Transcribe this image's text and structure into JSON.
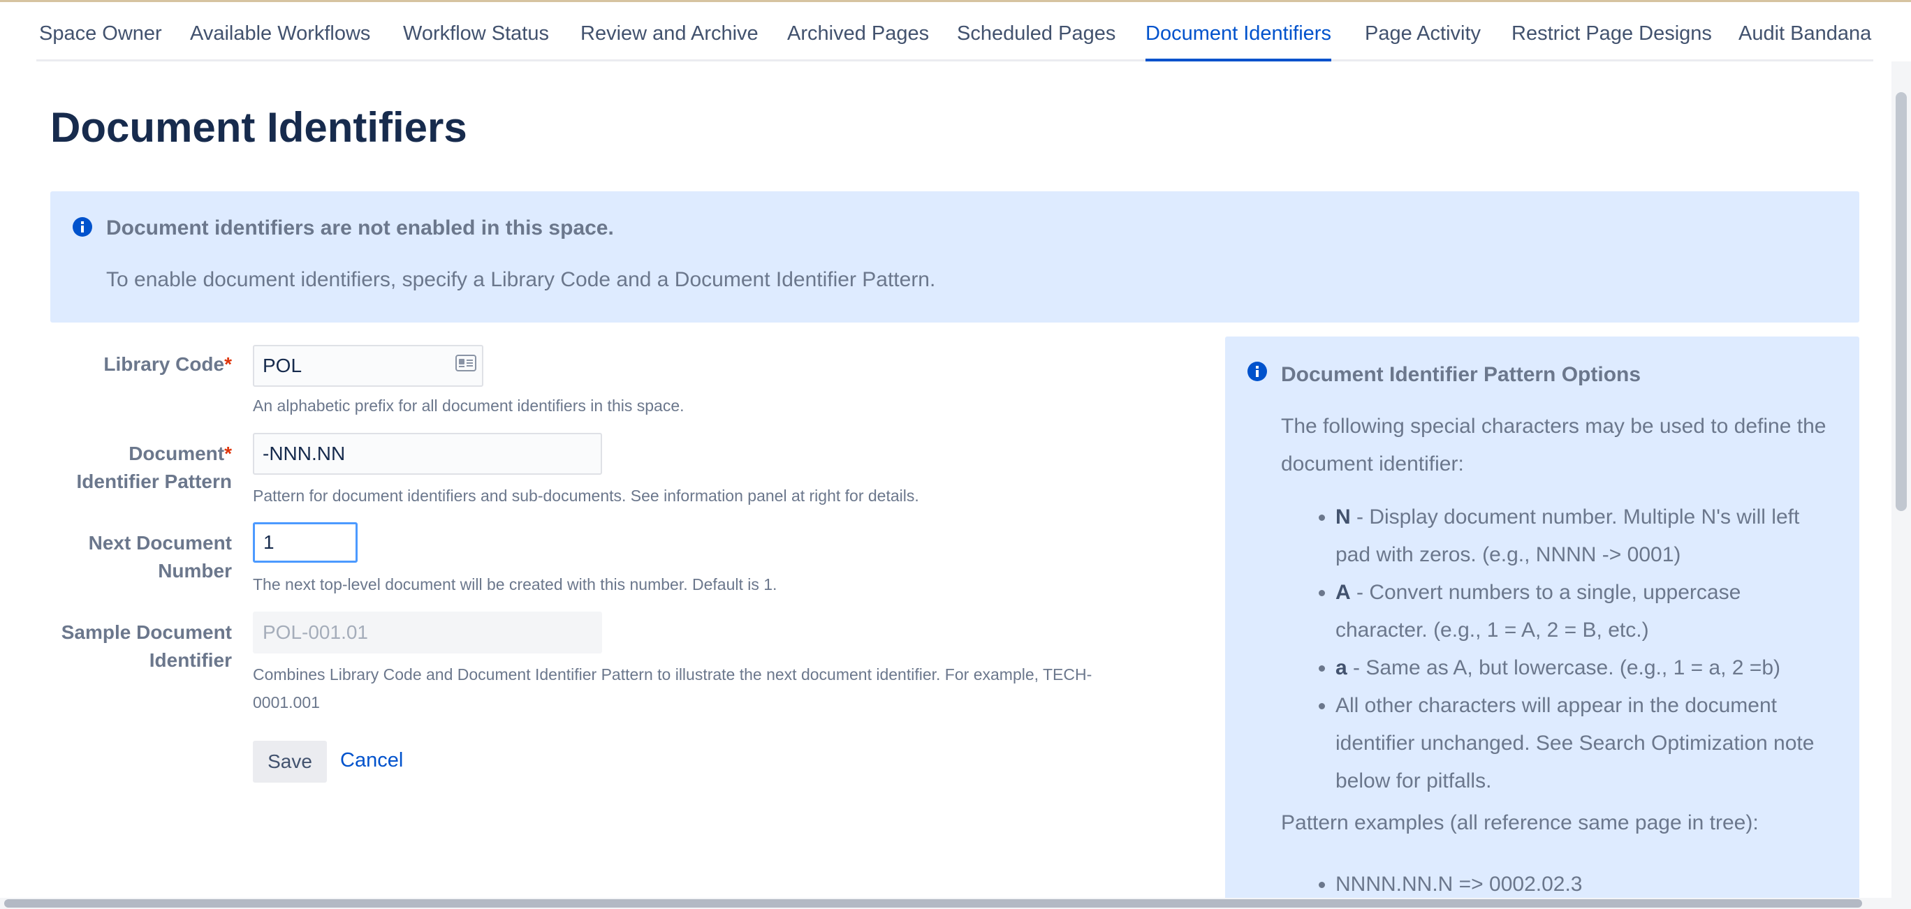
{
  "tabs": [
    {
      "label": "Space Owner"
    },
    {
      "label": "Available Workflows"
    },
    {
      "label": "Workflow Status"
    },
    {
      "label": "Review and Archive"
    },
    {
      "label": "Archived Pages"
    },
    {
      "label": "Scheduled Pages"
    },
    {
      "label": "Document Identifiers",
      "active": true
    },
    {
      "label": "Page Activity"
    },
    {
      "label": "Restrict Page Designs"
    },
    {
      "label": "Audit Bandana"
    }
  ],
  "page_title": "Document Identifiers",
  "banner": {
    "title": "Document identifiers are not enabled in this space.",
    "text": "To enable document identifiers, specify a Library Code and a Document Identifier Pattern."
  },
  "form": {
    "library_code": {
      "label": "Library Code",
      "required_mark": "*",
      "value": "POL",
      "help": "An alphabetic prefix for all document identifiers in this space."
    },
    "pattern": {
      "label_line1": "Document",
      "label_line2": "Identifier Pattern",
      "required_mark": "*",
      "value": "-NNN.NN",
      "help": "Pattern for document identifiers and sub-documents. See information panel at right for details."
    },
    "next_number": {
      "label_line1": "Next Document",
      "label_line2": "Number",
      "value": "1",
      "help": "The next top-level document will be created with this number. Default is 1."
    },
    "sample": {
      "label_line1": "Sample Document",
      "label_line2": "Identifier",
      "placeholder": "POL-001.01",
      "help_line1": "Combines Library Code and Document Identifier Pattern to illustrate the next document identifier. For example, TECH-",
      "help_line2": "0001.001"
    },
    "save_label": "Save",
    "cancel_label": "Cancel"
  },
  "panel": {
    "title": "Document Identifier Pattern Options",
    "intro": "The following special characters may be used to define the document identifier:",
    "options": [
      {
        "key": "N",
        "text": " - Display document number. Multiple N's will left pad with zeros. (e.g., NNNN -> 0001)"
      },
      {
        "key": "A",
        "text": " - Convert numbers to a single, uppercase character. (e.g., 1 = A, 2 = B, etc.)"
      },
      {
        "key": "a",
        "text": " - Same as A, but lowercase. (e.g., 1 = a, 2 =b)"
      },
      {
        "key": "",
        "text": "All other characters will appear in the document identifier unchanged. See Search Optimization note below for pitfalls."
      }
    ],
    "examples_intro": "Pattern examples (all reference same page in tree):",
    "examples": [
      "NNNN.NN.N => 0002.02.3"
    ]
  },
  "colors": {
    "accent": "#0052cc",
    "info_background": "#deebff",
    "required": "#de350b",
    "focus_border": "#4c9aff"
  }
}
